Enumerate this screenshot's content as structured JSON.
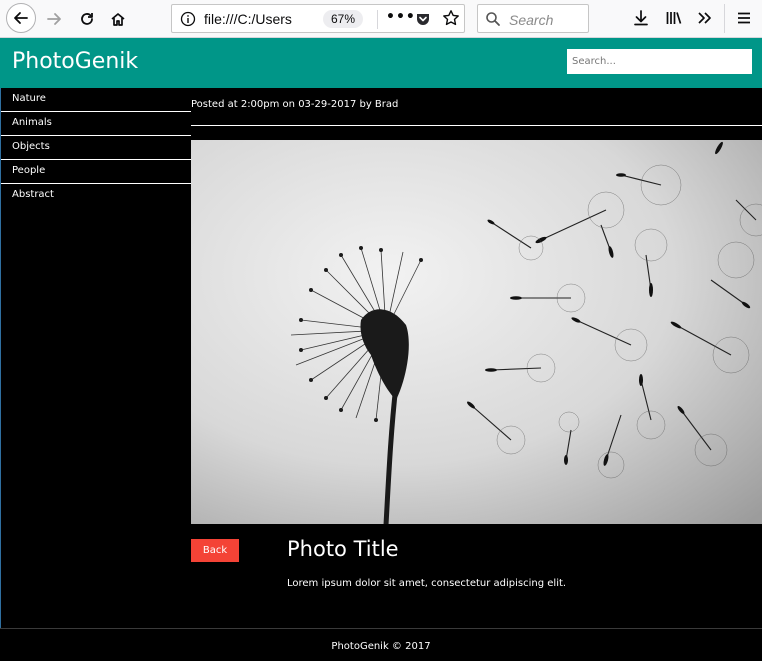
{
  "browser": {
    "url_text": "file:///C:/Users",
    "url_hidden_tail": "",
    "zoom": "67%",
    "search_placeholder": "Search",
    "icons": [
      "back-arrow-icon",
      "forward-arrow-icon",
      "reload-icon",
      "home-icon",
      "info-icon",
      "page-actions-icon",
      "pocket-icon",
      "bookmark-star-icon",
      "search-icon",
      "download-icon",
      "library-icon",
      "overflow-chevrons-icon",
      "hamburger-menu-icon"
    ]
  },
  "site": {
    "brand": "PhotoGenik",
    "search_placeholder": "Search...",
    "accent_color": "#009688"
  },
  "sidebar": {
    "items": [
      {
        "label": "Nature"
      },
      {
        "label": "Animals"
      },
      {
        "label": "Objects"
      },
      {
        "label": "People"
      },
      {
        "label": "Abstract"
      }
    ]
  },
  "post": {
    "meta": "Posted at 2:00pm on 03-29-2017 by Brad",
    "image_subject": "dandelion-photo",
    "back_label": "Back",
    "back_color": "#f44336",
    "title": "Photo Title",
    "description": "Lorem ipsum dolor sit amet, consectetur adipiscing elit."
  },
  "footer": {
    "text": "PhotoGenik © 2017"
  }
}
